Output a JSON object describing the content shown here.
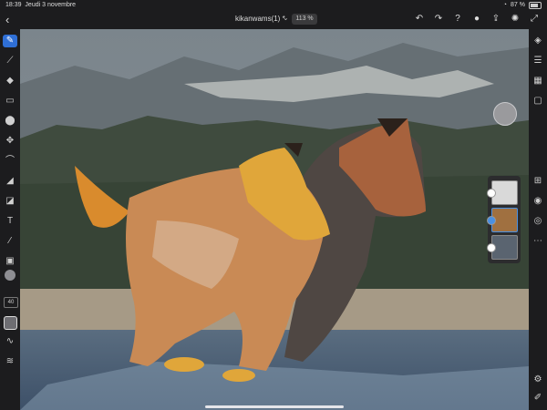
{
  "status": {
    "time": "18:39",
    "date": "Jeudi 3 novembre",
    "battery": "87 %"
  },
  "toolbar": {
    "doc_title": "kikanwams(1) *",
    "caret": "⌄",
    "zoom": "113 %"
  },
  "left_tools": {
    "brush_size": "40",
    "icons": [
      "brush-icon",
      "smudge-icon",
      "fill-icon",
      "eraser-icon",
      "clone-icon",
      "move-icon",
      "lasso-icon",
      "bucket-icon",
      "gradient-icon",
      "text-icon",
      "eyedropper-icon",
      "image-icon",
      "color-swatch",
      "size-box",
      "square-brush",
      "wave-icon",
      "adjust-icon"
    ]
  },
  "right_tools": {
    "icons": [
      "layers-icon",
      "sliders-icon",
      "grid-icon",
      "comment-icon",
      "add-layer-icon",
      "eye-icon",
      "blend-icon",
      "more-icon",
      "settings-icon",
      "pen-icon"
    ]
  },
  "layers": {
    "count": 3,
    "selected_index": 1
  },
  "colors": {
    "accent": "#2f6fd6",
    "chrome": "#1c1c1e",
    "layer_sel": "#4a90e2"
  }
}
